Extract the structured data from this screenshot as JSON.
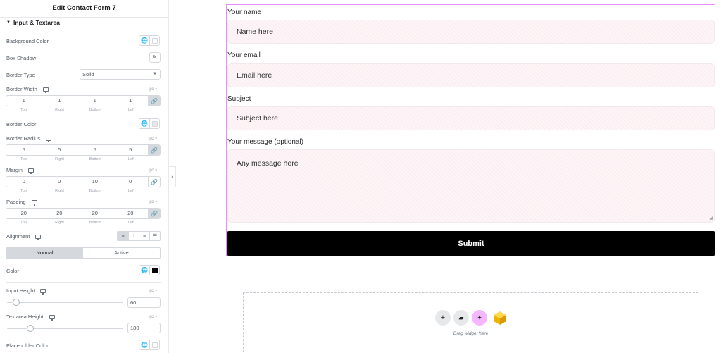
{
  "panel": {
    "title": "Edit Contact Form 7",
    "section": "Input & Textarea",
    "background_color_label": "Background Color",
    "box_shadow_label": "Box Shadow",
    "border_type_label": "Border Type",
    "border_type_value": "Solid",
    "border_width": {
      "label": "Border Width",
      "unit": "px",
      "values": [
        "1",
        "1",
        "1",
        "1"
      ],
      "linked": true
    },
    "border_color_label": "Border Color",
    "border_radius": {
      "label": "Border Radius",
      "unit": "px",
      "values": [
        "5",
        "5",
        "5",
        "5"
      ],
      "linked": true
    },
    "margin": {
      "label": "Margin",
      "unit": "px",
      "values": [
        "0",
        "0",
        "10",
        "0"
      ],
      "linked": false
    },
    "padding": {
      "label": "Padding",
      "unit": "px",
      "values": [
        "20",
        "20",
        "20",
        "20"
      ],
      "linked": true
    },
    "dim_labels": [
      "Top",
      "Right",
      "Bottom",
      "Left"
    ],
    "alignment_label": "Alignment",
    "tabs": [
      "Normal",
      "Active"
    ],
    "active_tab": "Normal",
    "color_label": "Color",
    "input_height": {
      "label": "Input Height",
      "unit": "px",
      "value": "60",
      "slider_fraction": 0.05
    },
    "textarea_height": {
      "label": "Textarea Height",
      "unit": "px",
      "value": "180",
      "slider_fraction": 0.17
    },
    "placeholder_color_label": "Placeholder Color",
    "colors": {
      "background_swatch": "#ffffff",
      "border_swatch": "#e6e8ea",
      "color_swatch": "#000000",
      "placeholder_swatch": "#ffffff"
    }
  },
  "form": {
    "fields": [
      {
        "label": "Your name",
        "placeholder": "Name here"
      },
      {
        "label": "Your email",
        "placeholder": "Email here"
      },
      {
        "label": "Subject",
        "placeholder": "Subject here"
      },
      {
        "label": "Your message (optional)",
        "placeholder": "Any message here"
      }
    ],
    "submit_label": "Submit",
    "accent_border": "#e78bff"
  },
  "dropzone": {
    "text": "Drag widget here",
    "buttons": [
      "plus-icon",
      "folder-icon",
      "ai-sparkle-icon",
      "box-icon"
    ]
  }
}
